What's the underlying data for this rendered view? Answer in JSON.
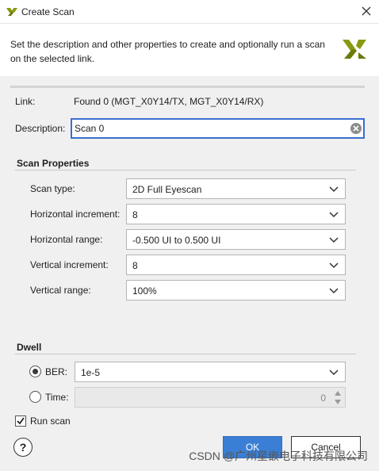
{
  "window": {
    "title": "Create Scan"
  },
  "header": {
    "text": "Set the description and other properties to create and optionally run a scan on the selected link."
  },
  "link": {
    "label": "Link:",
    "value": "Found 0 (MGT_X0Y14/TX, MGT_X0Y14/RX)"
  },
  "description": {
    "label": "Description:",
    "value": "Scan 0"
  },
  "scan_properties": {
    "title": "Scan Properties",
    "scan_type": {
      "label": "Scan type:",
      "value": "2D Full Eyescan"
    },
    "horizontal_increment": {
      "label": "Horizontal increment:",
      "value": "8"
    },
    "horizontal_range": {
      "label": "Horizontal range:",
      "value": "-0.500 UI to 0.500 UI"
    },
    "vertical_increment": {
      "label": "Vertical increment:",
      "value": "8"
    },
    "vertical_range": {
      "label": "Vertical range:",
      "value": "100%"
    }
  },
  "dwell": {
    "title": "Dwell",
    "ber": {
      "label": "BER:",
      "value": "1e-5",
      "selected": true
    },
    "time": {
      "label": "Time:",
      "value": "0",
      "selected": false
    }
  },
  "run_scan": {
    "label": "Run scan",
    "checked": true
  },
  "buttons": {
    "help": "?",
    "ok": "OK",
    "cancel": "Cancel"
  },
  "watermark": "CSDN @广州星嵌电子科技有限公司",
  "colors": {
    "accent": "#3a7fd5",
    "focus_border": "#3a6ed0",
    "logo": "#8a9a10"
  }
}
